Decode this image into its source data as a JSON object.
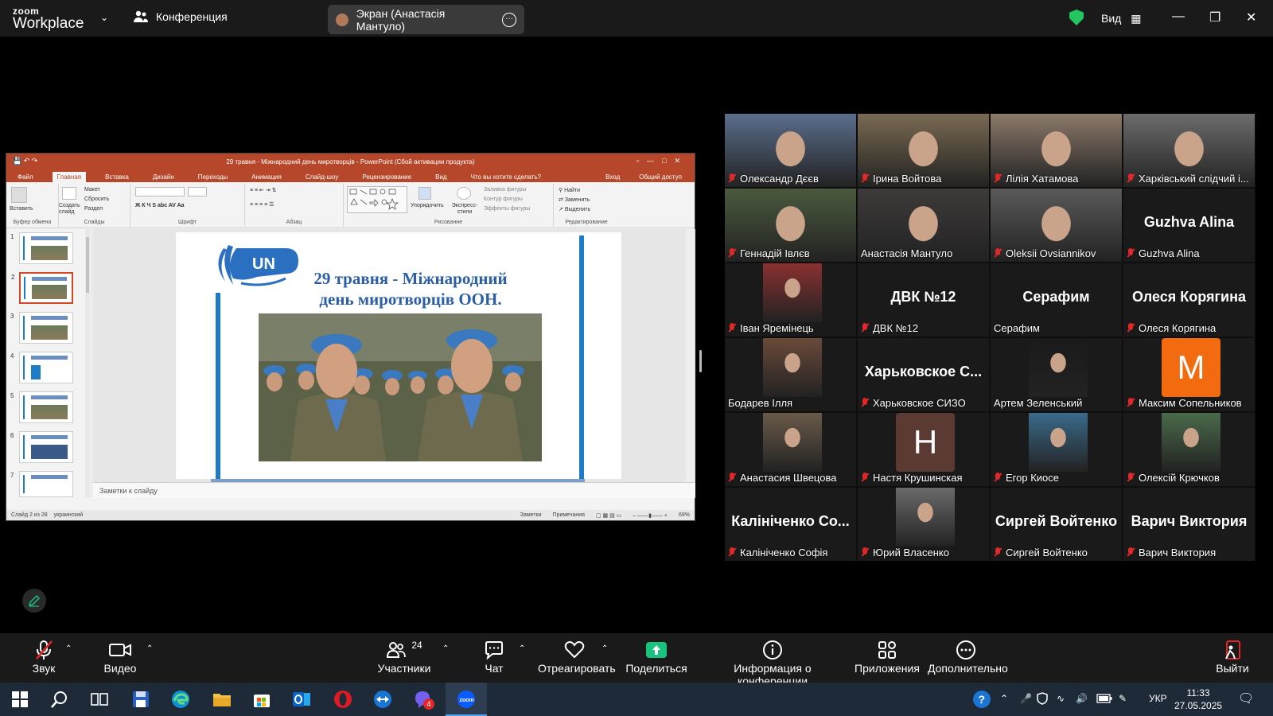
{
  "topbar": {
    "logo_line1": "zoom",
    "logo_line2": "Workplace",
    "meeting_label": "Конференция",
    "screen_share_label": "Экран (Анастасія Мантуло)",
    "view_label": "Вид"
  },
  "ppt": {
    "title": "29 травня - Міжнародний день миротворців - PowerPoint (Сбой активации продукта)",
    "tabs": [
      "Файл",
      "Главная",
      "Вставка",
      "Дизайн",
      "Переходы",
      "Анимация",
      "Слайд-шоу",
      "Рецензирование",
      "Вид",
      "Что вы хотите сделать?"
    ],
    "tabs_right": [
      "Вход",
      "Общий доступ"
    ],
    "ribbon": {
      "paste": "Вставить",
      "layout": "Макет",
      "reset": "Сбросить",
      "new_slide": "Создать слайд",
      "section": "Раздел",
      "arrange": "Упорядочить",
      "quick_styles": "Экспресс-стили",
      "fill": "Заливка фигуры",
      "outline": "Контур фигуры",
      "effects": "Эффекты фигуры",
      "find": "Найти",
      "replace": "Заменить",
      "select": "Выделить",
      "groups": [
        "Буфер обмена",
        "Слайды",
        "Шрифт",
        "Абзац",
        "Рисование",
        "Редактирование"
      ]
    },
    "thumb_numbers": [
      "1",
      "2",
      "3",
      "4",
      "5",
      "6",
      "7"
    ],
    "slide": {
      "logo_text": "UN",
      "title_line1": "29 травня - Міжнародний",
      "title_line2": "день миротворців ООН."
    },
    "notes_placeholder": "Заметки к слайду",
    "status": {
      "slide_of": "Слайд 2 из 28",
      "language": "украинский",
      "notes": "Заметки",
      "comments": "Примечания",
      "zoom": "69%"
    }
  },
  "participants": [
    {
      "name": "Олександр Дєєв",
      "muted": true,
      "kind": "video"
    },
    {
      "name": "Ірина Войтова",
      "muted": true,
      "kind": "video"
    },
    {
      "name": "Лілія Хатамова",
      "muted": true,
      "kind": "video"
    },
    {
      "name": "Харківський слідчий і...",
      "muted": true,
      "kind": "video"
    },
    {
      "name": "Геннадій Івлєв",
      "muted": true,
      "kind": "video"
    },
    {
      "name": "Анастасія Мантуло",
      "muted": false,
      "kind": "video",
      "active": true
    },
    {
      "name": "Oleksii Ovsiannikov",
      "muted": true,
      "kind": "video"
    },
    {
      "name": "Guzhva Alina",
      "muted": true,
      "kind": "name",
      "big": "Guzhva Alina"
    },
    {
      "name": "Іван Яремінець",
      "muted": true,
      "kind": "avatar"
    },
    {
      "name": "ДВК №12",
      "muted": true,
      "kind": "name",
      "big": "ДВК №12"
    },
    {
      "name": "Серафим",
      "muted": false,
      "kind": "name",
      "big": "Серафим"
    },
    {
      "name": "Олеся Корягина",
      "muted": true,
      "kind": "name",
      "big": "Олеся Корягина"
    },
    {
      "name": "Бодарев Ілля",
      "muted": false,
      "kind": "avatar"
    },
    {
      "name": "Харьковское СИЗО",
      "muted": true,
      "kind": "name",
      "big": "Харьковское С..."
    },
    {
      "name": "Артем Зеленський",
      "muted": false,
      "kind": "avatar"
    },
    {
      "name": "Максим Сопельников",
      "muted": true,
      "kind": "letter",
      "letter": "M",
      "color": "#f26b0f"
    },
    {
      "name": "Анастасия Швецова",
      "muted": true,
      "kind": "avatar"
    },
    {
      "name": "Настя Крушинская",
      "muted": true,
      "kind": "letter",
      "letter": "H",
      "color": "#5a3a33"
    },
    {
      "name": "Егор Киосе",
      "muted": true,
      "kind": "avatar"
    },
    {
      "name": "Олексій Крючков",
      "muted": true,
      "kind": "avatar"
    },
    {
      "name": "Калініченко Софія",
      "muted": true,
      "kind": "name",
      "big": "Калініченко Со..."
    },
    {
      "name": "Юрий Власенко",
      "muted": true,
      "kind": "avatar"
    },
    {
      "name": "Сиргей Войтенко",
      "muted": true,
      "kind": "name",
      "big": "Сиргей Войтенко"
    },
    {
      "name": "Варич Виктория",
      "muted": true,
      "kind": "name",
      "big": "Варич Виктория"
    }
  ],
  "toolbar": {
    "audio": "Звук",
    "video": "Видео",
    "participants": "Участники",
    "participants_count": "24",
    "chat": "Чат",
    "react": "Отреагировать",
    "share": "Поделиться",
    "info": "Информация о конференции",
    "apps": "Приложения",
    "more": "Дополнительно",
    "leave": "Выйти"
  },
  "taskbar": {
    "lang": "УКР",
    "time": "11:33",
    "date": "27.05.2025",
    "badge_count": "4"
  },
  "colors": {
    "active_speaker": "#22c55e",
    "share_green": "#19c37d",
    "muted_red": "#e02828",
    "ppt_accent": "#b7472a",
    "un_blue": "#2b5ea7"
  }
}
